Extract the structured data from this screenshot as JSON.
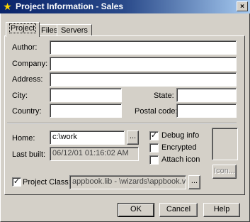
{
  "window": {
    "title": "Project Information - Sales",
    "close_label": "×"
  },
  "tabs": [
    {
      "label": "Project"
    },
    {
      "label": "Files"
    },
    {
      "label": "Servers"
    }
  ],
  "form": {
    "author_label": "Author:",
    "author_value": "",
    "company_label": "Company:",
    "company_value": "",
    "address_label": "Address:",
    "address_value": "",
    "city_label": "City:",
    "city_value": "",
    "state_label": "State:",
    "state_value": "",
    "country_label": "Country:",
    "country_value": "",
    "postal_label": "Postal code:",
    "postal_value": "",
    "home_label": "Home:",
    "home_value": "c:\\work",
    "browse_label": "...",
    "last_built_label": "Last built:",
    "last_built_value": "06/12/01 01:16:02 AM",
    "project_class_label": "Project Class:",
    "project_class_value": "appbook.lib - \\wizards\\appbook.vcx)",
    "class_browse_label": "..."
  },
  "options": {
    "debug_label": "Debug info",
    "debug_checked": true,
    "encrypted_label": "Encrypted",
    "encrypted_checked": false,
    "attach_label": "Attach icon",
    "attach_checked": false,
    "project_class_checked": true,
    "icon_button_label": "Icon..."
  },
  "footer": {
    "ok_label": "OK",
    "cancel_label": "Cancel",
    "help_label": "Help"
  },
  "colors": {
    "titlebar_start": "#0a246a",
    "titlebar_end": "#a6caf0",
    "face": "#d4d0c8"
  }
}
